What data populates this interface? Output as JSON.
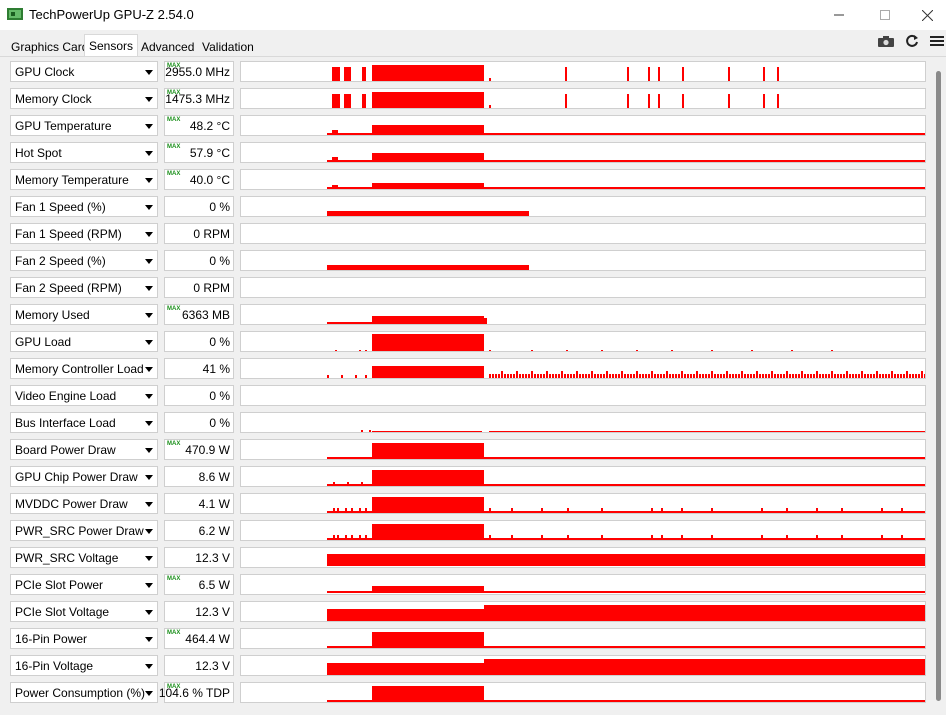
{
  "window": {
    "title": "TechPowerUp GPU-Z 2.54.0",
    "colors": {
      "graph": "#ff0000",
      "max_tag": "#1a8f1a"
    }
  },
  "tabs": [
    {
      "label": "Graphics Card",
      "active": false
    },
    {
      "label": "Sensors",
      "active": true
    },
    {
      "label": "Advanced",
      "active": false
    },
    {
      "label": "Validation",
      "active": false
    }
  ],
  "toolbar": {
    "icons": [
      "camera-icon",
      "refresh-icon",
      "menu-icon"
    ]
  },
  "sensors": [
    {
      "label": "GPU Clock",
      "value": "2955.0 MHz",
      "max": true,
      "max_tag": "MAX",
      "graph": "clock"
    },
    {
      "label": "Memory Clock",
      "value": "1475.3 MHz",
      "max": true,
      "max_tag": "MAX",
      "graph": "clock"
    },
    {
      "label": "GPU Temperature",
      "value": "48.2 °C",
      "max": true,
      "max_tag": "MAX",
      "graph": "temp"
    },
    {
      "label": "Hot Spot",
      "value": "57.9 °C",
      "max": true,
      "max_tag": "MAX",
      "graph": "temp2"
    },
    {
      "label": "Memory Temperature",
      "value": "40.0 °C",
      "max": true,
      "max_tag": "MAX",
      "graph": "temp3"
    },
    {
      "label": "Fan 1 Speed (%)",
      "value": "0 %",
      "max": false,
      "max_tag": "",
      "graph": "fan"
    },
    {
      "label": "Fan 1 Speed (RPM)",
      "value": "0 RPM",
      "max": false,
      "max_tag": "",
      "graph": "none"
    },
    {
      "label": "Fan 2 Speed (%)",
      "value": "0 %",
      "max": false,
      "max_tag": "",
      "graph": "fan"
    },
    {
      "label": "Fan 2 Speed (RPM)",
      "value": "0 RPM",
      "max": false,
      "max_tag": "",
      "graph": "none"
    },
    {
      "label": "Memory Used",
      "value": "6363 MB",
      "max": true,
      "max_tag": "MAX",
      "graph": "mem"
    },
    {
      "label": "GPU Load",
      "value": "0 %",
      "max": false,
      "max_tag": "",
      "graph": "load"
    },
    {
      "label": "Memory Controller Load",
      "value": "41 %",
      "max": false,
      "max_tag": "",
      "graph": "mcload"
    },
    {
      "label": "Video Engine Load",
      "value": "0 %",
      "max": false,
      "max_tag": "",
      "graph": "none"
    },
    {
      "label": "Bus Interface Load",
      "value": "0 %",
      "max": false,
      "max_tag": "",
      "graph": "bus"
    },
    {
      "label": "Board Power Draw",
      "value": "470.9 W",
      "max": true,
      "max_tag": "MAX",
      "graph": "power"
    },
    {
      "label": "GPU Chip Power Draw",
      "value": "8.6 W",
      "max": false,
      "max_tag": "",
      "graph": "power2"
    },
    {
      "label": "MVDDC Power Draw",
      "value": "4.1 W",
      "max": false,
      "max_tag": "",
      "graph": "power3"
    },
    {
      "label": "PWR_SRC Power Draw",
      "value": "6.2 W",
      "max": false,
      "max_tag": "",
      "graph": "power3"
    },
    {
      "label": "PWR_SRC Voltage",
      "value": "12.3 V",
      "max": false,
      "max_tag": "",
      "graph": "voltage"
    },
    {
      "label": "PCIe Slot Power",
      "value": "6.5 W",
      "max": true,
      "max_tag": "MAX",
      "graph": "power4"
    },
    {
      "label": "PCIe Slot Voltage",
      "value": "12.3 V",
      "max": false,
      "max_tag": "",
      "graph": "voltage2"
    },
    {
      "label": "16-Pin Power",
      "value": "464.4 W",
      "max": true,
      "max_tag": "MAX",
      "graph": "power"
    },
    {
      "label": "16-Pin Voltage",
      "value": "12.3 V",
      "max": false,
      "max_tag": "",
      "graph": "voltage2"
    },
    {
      "label": "Power Consumption (%)",
      "value": "104.6 % TDP",
      "max": true,
      "max_tag": "MAX",
      "graph": "power"
    }
  ]
}
